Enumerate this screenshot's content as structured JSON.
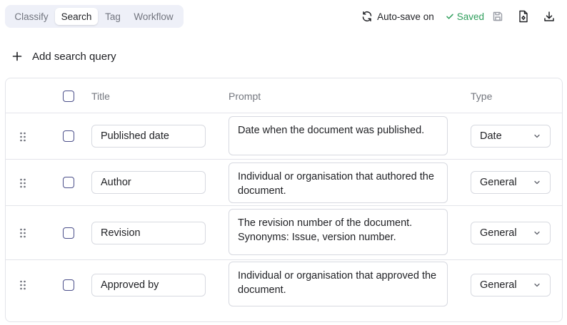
{
  "tabs": [
    {
      "label": "Classify",
      "active": false
    },
    {
      "label": "Search",
      "active": true
    },
    {
      "label": "Tag",
      "active": false
    },
    {
      "label": "Workflow",
      "active": false
    }
  ],
  "toolbar": {
    "autosave_label": "Auto-save on",
    "saved_label": "Saved",
    "icons": [
      "refresh-icon",
      "check-icon",
      "save-icon",
      "file-settings-icon",
      "download-icon"
    ],
    "saved_color": "#2e9e5b"
  },
  "add_query_label": "Add search query",
  "table": {
    "columns": {
      "title": "Title",
      "prompt": "Prompt",
      "type": "Type"
    },
    "rows": [
      {
        "title": "Published date",
        "prompt": "Date when the document was published.",
        "type": "Date"
      },
      {
        "title": "Author",
        "prompt": "Individual or organisation that authored the document.",
        "type": "General"
      },
      {
        "title": "Revision",
        "prompt": "The revision number of the document.\nSynonyms: Issue, version number.",
        "type": "General"
      },
      {
        "title": "Approved by",
        "prompt": "Individual or organisation that approved the document.",
        "type": "General"
      }
    ]
  },
  "colors": {
    "checkbox_border": "#4b4f8a",
    "active_tab_bg": "#ffffff",
    "tabs_bg": "#eef0f8"
  }
}
